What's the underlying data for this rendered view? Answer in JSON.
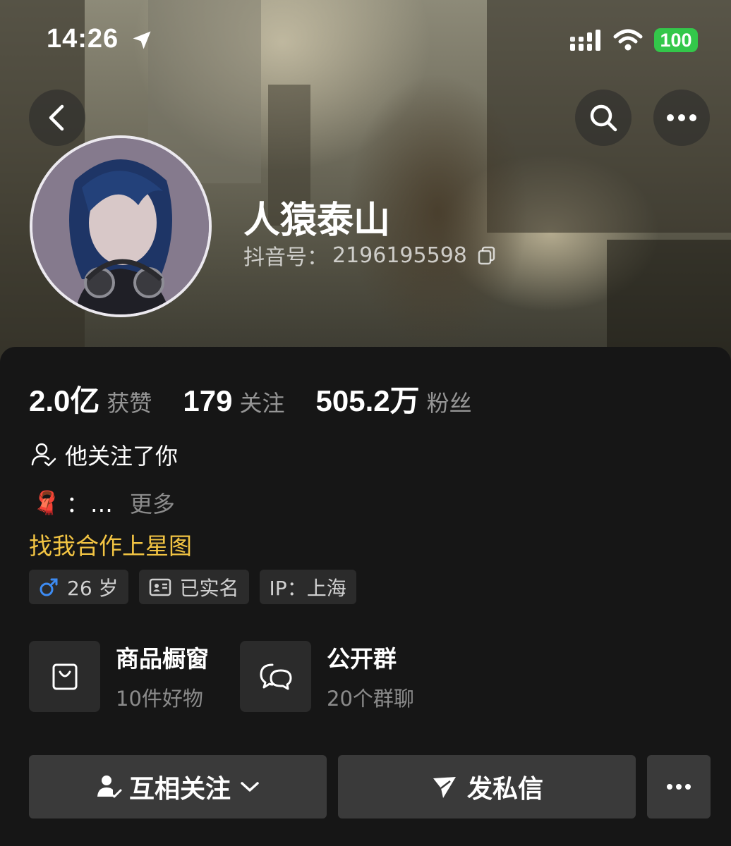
{
  "status_bar": {
    "time": "14:26",
    "battery": "100"
  },
  "header": {
    "back_icon": "chevron-left-icon",
    "search_icon": "search-icon",
    "more_icon": "ellipsis-icon"
  },
  "profile": {
    "nickname": "人猿泰山",
    "douyin_id_label": "抖音号：",
    "douyin_id": "2196195598"
  },
  "stats": [
    {
      "value": "2.0亿",
      "label": "获赞"
    },
    {
      "value": "179",
      "label": "关注"
    },
    {
      "value": "505.2万",
      "label": "粉丝"
    }
  ],
  "follow_tip": "他关注了你",
  "bio": {
    "emoji": "🧣",
    "text": "：…",
    "more": "更多"
  },
  "star_link": "找我合作上星图",
  "tags": [
    {
      "icon": "male-icon",
      "label": "26 岁",
      "icon_color": "#3d8bf2"
    },
    {
      "icon": "id-card-icon",
      "label": "已实名"
    },
    {
      "icon": "",
      "label": "IP：上海"
    }
  ],
  "cards": [
    {
      "icon": "shopping-bag-icon",
      "title": "商品橱窗",
      "subtitle": "10件好物"
    },
    {
      "icon": "chat-bubbles-icon",
      "title": "公开群",
      "subtitle": "20个群聊"
    }
  ],
  "actions": {
    "mutual_follow": "互相关注",
    "message": "发私信",
    "more_icon": "ellipsis-icon"
  },
  "colors": {
    "accent_yellow": "#f2c443",
    "battery_green": "#33c74a",
    "panel_bg": "#161616",
    "chip_bg": "#2b2b2b"
  }
}
